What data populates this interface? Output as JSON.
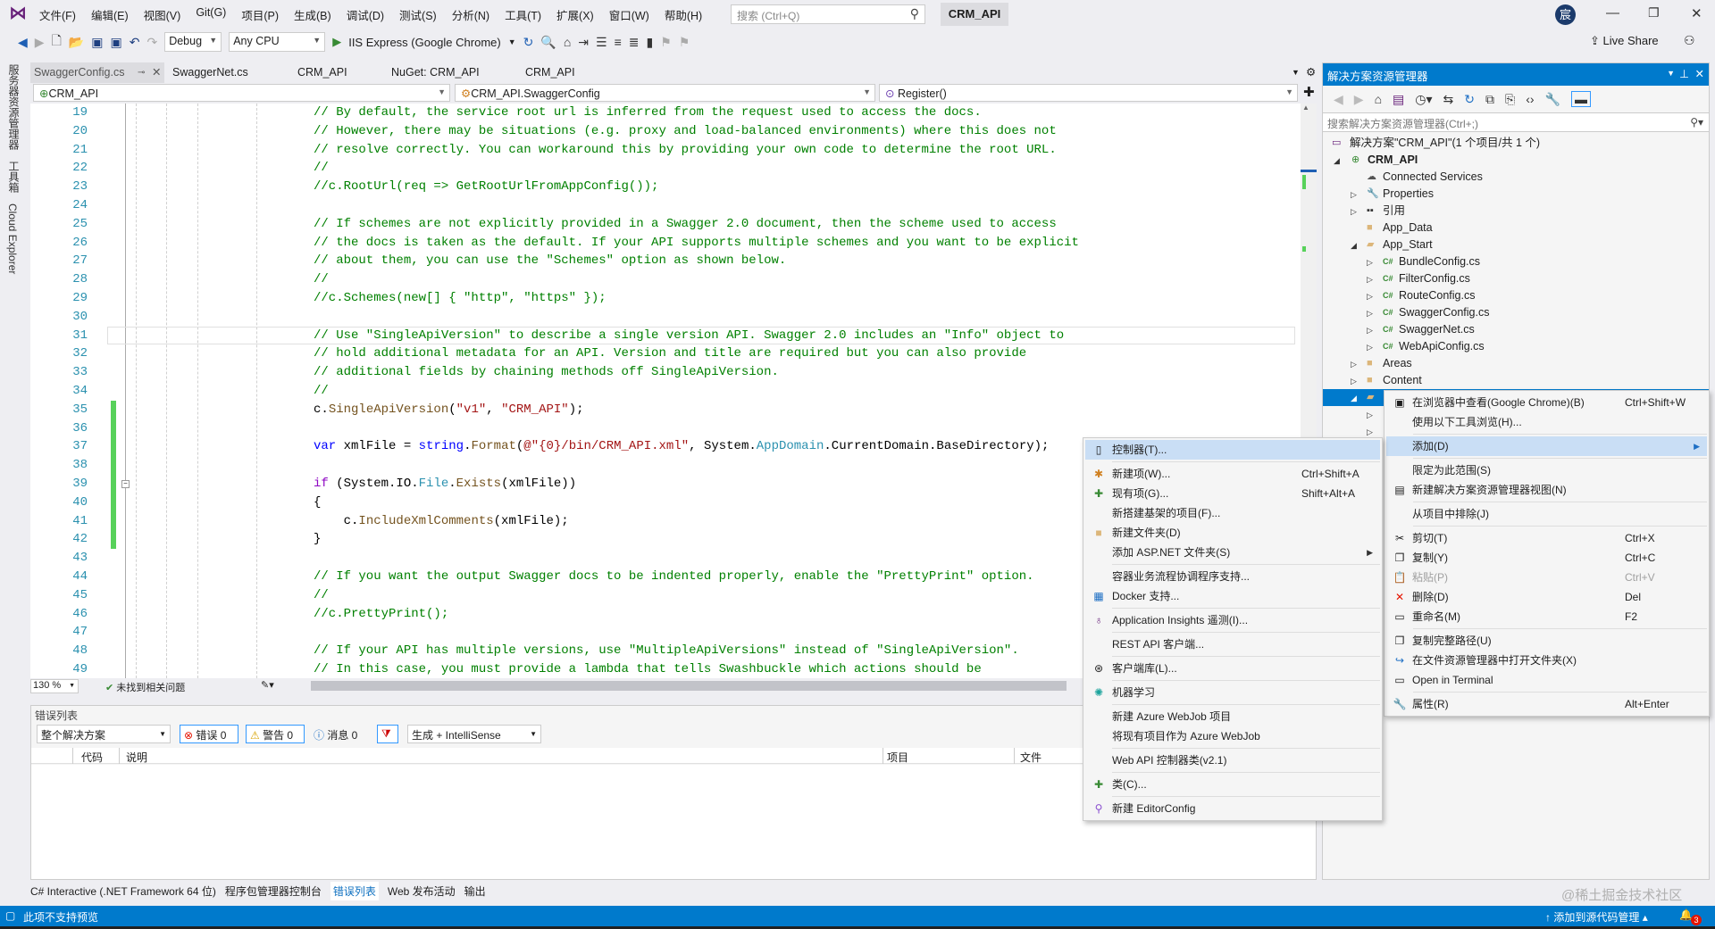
{
  "titlebar": {
    "menus": [
      "文件(F)",
      "编辑(E)",
      "视图(V)",
      "Git(G)",
      "项目(P)",
      "生成(B)",
      "调试(D)",
      "测试(S)",
      "分析(N)",
      "工具(T)",
      "扩展(X)",
      "窗口(W)",
      "帮助(H)"
    ],
    "search_placeholder": "搜索 (Ctrl+Q)",
    "solution_name": "CRM_API",
    "avatar_initial": "宸",
    "live_share": "Live Share"
  },
  "toolbar": {
    "configuration": "Debug",
    "platform": "Any CPU",
    "run_target": "IIS Express (Google Chrome)"
  },
  "left_strip": [
    "服务器资源管理器",
    "工具箱",
    "Cloud Explorer"
  ],
  "doc_tabs": [
    {
      "label": "SwaggerConfig.cs",
      "active": true
    },
    {
      "label": "SwaggerNet.cs"
    },
    {
      "label": "CRM_API"
    },
    {
      "label": "NuGet: CRM_API"
    },
    {
      "label": "CRM_API"
    }
  ],
  "navbar": {
    "project": "CRM_API",
    "type": "CRM_API.SwaggerConfig",
    "member": "Register()"
  },
  "code": {
    "current_line": 31,
    "changed_lines": [
      35,
      36,
      37,
      38,
      39,
      40,
      41,
      42
    ],
    "lines": [
      {
        "n": 19,
        "tokens": [
          [
            "// By default, the service root url is inferred from the request used to access the docs.",
            "cm"
          ]
        ]
      },
      {
        "n": 20,
        "tokens": [
          [
            "// However, there may be situations (e.g. proxy and load-balanced environments) where this does not",
            "cm"
          ]
        ]
      },
      {
        "n": 21,
        "tokens": [
          [
            "// resolve correctly. You can workaround this by providing your own code to determine the root URL.",
            "cm"
          ]
        ]
      },
      {
        "n": 22,
        "tokens": [
          [
            "//",
            "cm"
          ]
        ]
      },
      {
        "n": 23,
        "tokens": [
          [
            "//c.RootUrl(req => GetRootUrlFromAppConfig());",
            "cm"
          ]
        ]
      },
      {
        "n": 24,
        "tokens": []
      },
      {
        "n": 25,
        "tokens": [
          [
            "// If schemes are not explicitly provided in a Swagger 2.0 document, then the scheme used to access",
            "cm"
          ]
        ]
      },
      {
        "n": 26,
        "tokens": [
          [
            "// the docs is taken as the default. If your API supports multiple schemes and you want to be explicit",
            "cm"
          ]
        ]
      },
      {
        "n": 27,
        "tokens": [
          [
            "// about them, you can use the \"Schemes\" option as shown below.",
            "cm"
          ]
        ]
      },
      {
        "n": 28,
        "tokens": [
          [
            "//",
            "cm"
          ]
        ]
      },
      {
        "n": 29,
        "tokens": [
          [
            "//c.Schemes(new[] { \"http\", \"https\" });",
            "cm"
          ]
        ]
      },
      {
        "n": 30,
        "tokens": []
      },
      {
        "n": 31,
        "tokens": [
          [
            "// Use \"SingleApiVersion\" to describe a single version API. Swagger 2.0 includes an \"Info\" object to",
            "cm"
          ]
        ]
      },
      {
        "n": 32,
        "tokens": [
          [
            "// hold additional metadata for an API. Version and title are required but you can also provide",
            "cm"
          ]
        ]
      },
      {
        "n": 33,
        "tokens": [
          [
            "// additional fields by chaining methods off SingleApiVersion.",
            "cm"
          ]
        ]
      },
      {
        "n": 34,
        "tokens": [
          [
            "//",
            "cm"
          ]
        ]
      },
      {
        "n": 35,
        "tokens": [
          [
            "c.",
            "pl"
          ],
          [
            "SingleApiVersion",
            "fn"
          ],
          [
            "(",
            "pl"
          ],
          [
            "\"v1\"",
            "str"
          ],
          [
            ", ",
            "pl"
          ],
          [
            "\"CRM_API\"",
            "str"
          ],
          [
            ");",
            "pl"
          ]
        ]
      },
      {
        "n": 36,
        "tokens": []
      },
      {
        "n": 37,
        "tokens": [
          [
            "var",
            "kw"
          ],
          [
            " xmlFile = ",
            "pl"
          ],
          [
            "string",
            "kw"
          ],
          [
            ".",
            "pl"
          ],
          [
            "Format",
            "fn"
          ],
          [
            "(",
            "pl"
          ],
          [
            "@\"{0}/bin/CRM_API.xml\"",
            "str"
          ],
          [
            ", System.",
            "pl"
          ],
          [
            "AppDomain",
            "ty"
          ],
          [
            ".CurrentDomain.BaseDirectory);",
            "pl"
          ]
        ]
      },
      {
        "n": 38,
        "tokens": []
      },
      {
        "n": 39,
        "tokens": [
          [
            "if",
            "ctl"
          ],
          [
            " (System.IO.",
            "pl"
          ],
          [
            "File",
            "ty"
          ],
          [
            ".",
            "pl"
          ],
          [
            "Exists",
            "fn"
          ],
          [
            "(xmlFile))",
            "pl"
          ]
        ]
      },
      {
        "n": 40,
        "tokens": [
          [
            "{",
            "pl"
          ]
        ]
      },
      {
        "n": 41,
        "tokens": [
          [
            "    c.",
            "pl"
          ],
          [
            "IncludeXmlComments",
            "fn"
          ],
          [
            "(xmlFile);",
            "pl"
          ]
        ]
      },
      {
        "n": 42,
        "tokens": [
          [
            "}",
            "pl"
          ]
        ]
      },
      {
        "n": 43,
        "tokens": []
      },
      {
        "n": 44,
        "tokens": [
          [
            "// If you want the output Swagger docs to be indented properly, enable the \"PrettyPrint\" option.",
            "cm"
          ]
        ]
      },
      {
        "n": 45,
        "tokens": [
          [
            "//",
            "cm"
          ]
        ]
      },
      {
        "n": 46,
        "tokens": [
          [
            "//c.PrettyPrint();",
            "cm"
          ]
        ]
      },
      {
        "n": 47,
        "tokens": []
      },
      {
        "n": 48,
        "tokens": [
          [
            "// If your API has multiple versions, use \"MultipleApiVersions\" instead of \"SingleApiVersion\".",
            "cm"
          ]
        ]
      },
      {
        "n": 49,
        "tokens": [
          [
            "// In this case, you must provide a lambda that tells Swashbuckle which actions should be",
            "cm"
          ]
        ]
      }
    ]
  },
  "editor_status": {
    "zoom": "130 %",
    "issues": "未找到相关问题"
  },
  "error_list": {
    "title": "错误列表",
    "scope": "整个解决方案",
    "errors": "错误 0",
    "warnings": "警告 0",
    "messages": "消息 0",
    "source": "生成 + IntelliSense",
    "columns": [
      "代码",
      "说明",
      "项目",
      "文件"
    ]
  },
  "bottom_tabs": [
    {
      "label": "C# Interactive (.NET Framework 64 位)"
    },
    {
      "label": "程序包管理器控制台"
    },
    {
      "label": "错误列表",
      "active": true
    },
    {
      "label": "Web 发布活动"
    },
    {
      "label": "输出"
    }
  ],
  "statusbar": {
    "left": "此项不支持预览",
    "source_control": "添加到源代码管理",
    "notifications": "3"
  },
  "watermark": "@稀土掘金技术社区",
  "solution_explorer": {
    "title": "解决方案资源管理器",
    "search_placeholder": "搜索解决方案资源管理器(Ctrl+;)",
    "tree": [
      {
        "label": "解决方案\"CRM_API\"(1 个项目/共 1 个)",
        "level": 0,
        "exp": "",
        "icon": "solution-icon"
      },
      {
        "label": "CRM_API",
        "level": 0,
        "exp": "open",
        "icon": "web-project-icon",
        "bold": true
      },
      {
        "label": "Connected Services",
        "level": 1,
        "exp": "",
        "icon": "connected-services-icon"
      },
      {
        "label": "Properties",
        "level": 1,
        "exp": "closed",
        "icon": "wrench-icon"
      },
      {
        "label": "引用",
        "level": 1,
        "exp": "closed",
        "icon": "references-icon"
      },
      {
        "label": "App_Data",
        "level": 1,
        "exp": "",
        "icon": "folder-icon"
      },
      {
        "label": "App_Start",
        "level": 1,
        "exp": "open",
        "icon": "folder-open-icon"
      },
      {
        "label": "BundleConfig.cs",
        "level": 2,
        "exp": "closed",
        "icon": "csharp-file-icon"
      },
      {
        "label": "FilterConfig.cs",
        "level": 2,
        "exp": "closed",
        "icon": "csharp-file-icon"
      },
      {
        "label": "RouteConfig.cs",
        "level": 2,
        "exp": "closed",
        "icon": "csharp-file-icon"
      },
      {
        "label": "SwaggerConfig.cs",
        "level": 2,
        "exp": "closed",
        "icon": "csharp-file-icon"
      },
      {
        "label": "SwaggerNet.cs",
        "level": 2,
        "exp": "closed",
        "icon": "csharp-file-icon"
      },
      {
        "label": "WebApiConfig.cs",
        "level": 2,
        "exp": "closed",
        "icon": "csharp-file-icon"
      },
      {
        "label": "Areas",
        "level": 1,
        "exp": "closed",
        "icon": "folder-icon"
      },
      {
        "label": "Content",
        "level": 1,
        "exp": "closed",
        "icon": "folder-icon"
      },
      {
        "label": "",
        "level": 1,
        "exp": "open",
        "icon": "folder-open-icon",
        "selected": true
      },
      {
        "label": "",
        "level": 2,
        "exp": "closed",
        "icon": ""
      },
      {
        "label": "",
        "level": 2,
        "exp": "closed",
        "icon": ""
      }
    ]
  },
  "context_menu": [
    {
      "label": "在浏览器中查看(Google Chrome)(B)",
      "shortcut": "Ctrl+Shift+W",
      "icon": "browser-icon"
    },
    {
      "label": "使用以下工具浏览(H)..."
    },
    {
      "sep": true
    },
    {
      "label": "添加(D)",
      "submenu": true,
      "highlighted": true
    },
    {
      "sep": true
    },
    {
      "label": "限定为此范围(S)"
    },
    {
      "label": "新建解决方案资源管理器视图(N)",
      "icon": "new-view-icon"
    },
    {
      "sep": true
    },
    {
      "label": "从项目中排除(J)"
    },
    {
      "sep": true
    },
    {
      "label": "剪切(T)",
      "shortcut": "Ctrl+X",
      "icon": "scissors-icon"
    },
    {
      "label": "复制(Y)",
      "shortcut": "Ctrl+C",
      "icon": "copy-icon"
    },
    {
      "label": "粘贴(P)",
      "shortcut": "Ctrl+V",
      "icon": "paste-icon",
      "disabled": true
    },
    {
      "label": "删除(D)",
      "shortcut": "Del",
      "icon": "delete-icon"
    },
    {
      "label": "重命名(M)",
      "shortcut": "F2",
      "icon": "rename-icon"
    },
    {
      "sep": true
    },
    {
      "label": "复制完整路径(U)",
      "icon": "copy-path-icon"
    },
    {
      "label": "在文件资源管理器中打开文件夹(X)",
      "icon": "open-folder-arrow-icon"
    },
    {
      "label": "Open in Terminal",
      "icon": "terminal-icon"
    },
    {
      "sep": true
    },
    {
      "label": "属性(R)",
      "shortcut": "Alt+Enter",
      "icon": "wrench-icon"
    }
  ],
  "add_submenu": [
    {
      "label": "控制器(T)...",
      "icon": "controller-icon",
      "highlighted": true
    },
    {
      "sep": true
    },
    {
      "label": "新建项(W)...",
      "shortcut": "Ctrl+Shift+A",
      "icon": "new-item-icon"
    },
    {
      "label": "现有项(G)...",
      "shortcut": "Shift+Alt+A",
      "icon": "existing-item-icon"
    },
    {
      "label": "新搭建基架的项目(F)..."
    },
    {
      "label": "新建文件夹(D)",
      "icon": "new-folder-icon"
    },
    {
      "label": "添加 ASP.NET 文件夹(S)",
      "submenu": true
    },
    {
      "sep": true
    },
    {
      "label": "容器业务流程协调程序支持..."
    },
    {
      "label": "Docker 支持...",
      "icon": "docker-icon"
    },
    {
      "sep": true
    },
    {
      "label": "Application Insights 遥测(I)...",
      "icon": "insights-icon"
    },
    {
      "sep": true
    },
    {
      "label": "REST API 客户端..."
    },
    {
      "sep": true
    },
    {
      "label": "客户端库(L)...",
      "icon": "client-library-icon"
    },
    {
      "sep": true
    },
    {
      "label": "机器学习",
      "icon": "ml-icon"
    },
    {
      "sep": true
    },
    {
      "label": "新建 Azure WebJob 项目"
    },
    {
      "label": "将现有项目作为 Azure WebJob"
    },
    {
      "sep": true
    },
    {
      "label": "Web API 控制器类(v2.1)"
    },
    {
      "sep": true
    },
    {
      "label": "类(C)...",
      "icon": "class-icon"
    },
    {
      "sep": true
    },
    {
      "label": "新建 EditorConfig",
      "icon": "lightbulb-icon"
    }
  ],
  "colors": {
    "accent": "#007acc",
    "menu_highlight": "#c9def5",
    "change_bar": "#57d15a",
    "comment": "#008000",
    "keyword": "#0000ff",
    "string": "#a31515",
    "type": "#2b91af"
  }
}
